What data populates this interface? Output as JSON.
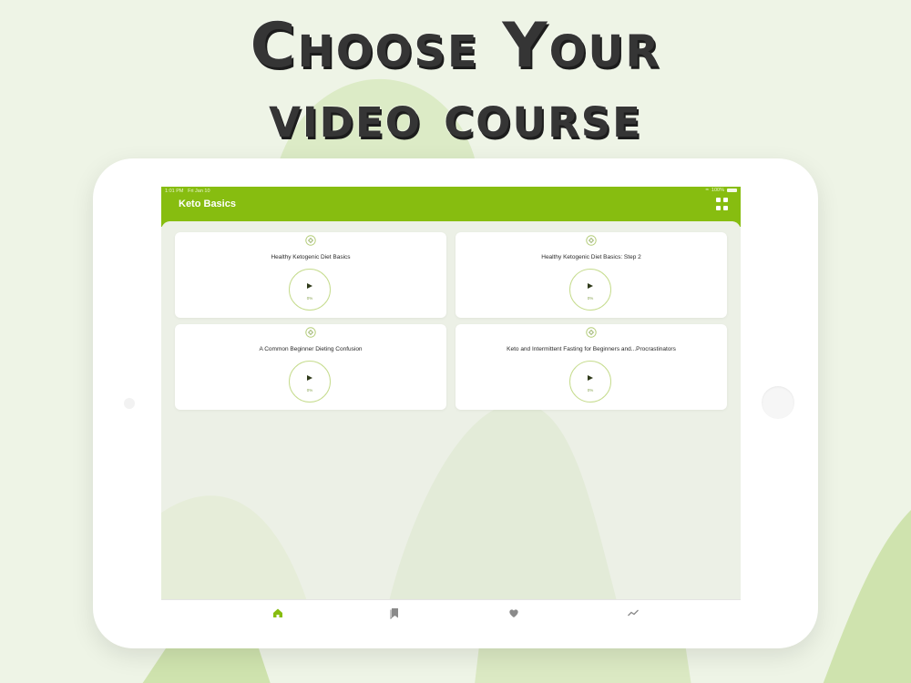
{
  "headline": {
    "line1": "Choose Your",
    "line2": "video course"
  },
  "status_bar": {
    "time": "1:01 PM",
    "date": "Fri Jan 10",
    "battery": "100%"
  },
  "app": {
    "title": "Keto Basics",
    "menu_icon": "grid-icon"
  },
  "courses": [
    {
      "title": "Healthy Ketogenic Diet Basics",
      "progress": "0%",
      "icon": "badge-icon"
    },
    {
      "title": "Healthy Ketogenic Diet Basics: Step 2",
      "progress": "0%",
      "icon": "badge-icon"
    },
    {
      "title": "A Common Beginner Dieting Confusion",
      "progress": "0%",
      "icon": "badge-icon"
    },
    {
      "title": "Keto and Intermittent Fasting for Beginners and...Procrastinators",
      "progress": "0%",
      "icon": "badge-icon"
    }
  ],
  "tabs": [
    {
      "icon": "home-icon",
      "active": true
    },
    {
      "icon": "bookmark-icon",
      "active": false
    },
    {
      "icon": "heart-icon",
      "active": false
    },
    {
      "icon": "trend-icon",
      "active": false
    }
  ],
  "colors": {
    "accent": "#87bd10",
    "background": "#eef4e6",
    "headline": "#353535",
    "tab_active": "#87bd10",
    "tab_inactive": "#8a8a8a"
  }
}
